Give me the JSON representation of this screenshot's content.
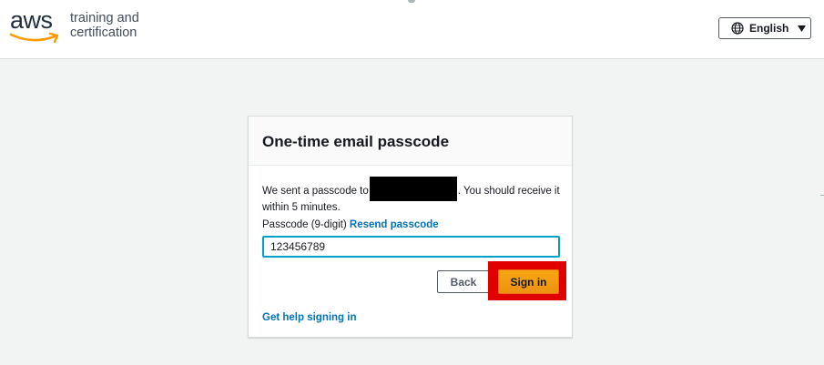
{
  "header": {
    "logo_text": "aws",
    "brand_line1": "training and",
    "brand_line2": "certification",
    "language_label": "English"
  },
  "card": {
    "title": "One-time email passcode",
    "message_before": "We sent a passcode to",
    "message_after": ". You should receive it within 5 minutes.",
    "passcode_label": "Passcode (9-digit)",
    "resend_link": "Resend passcode",
    "passcode_value": "123456789",
    "back_label": "Back",
    "signin_label": "Sign in",
    "help_link": "Get help signing in"
  },
  "colors": {
    "accent_orange": "#ec9211",
    "link_blue": "#0073bb",
    "highlight_red": "#e00000",
    "input_focus": "#00a1c9"
  },
  "icons": {
    "language": "globe-icon",
    "dropdown": "caret-down-icon",
    "logo": "aws-smile-logo"
  }
}
